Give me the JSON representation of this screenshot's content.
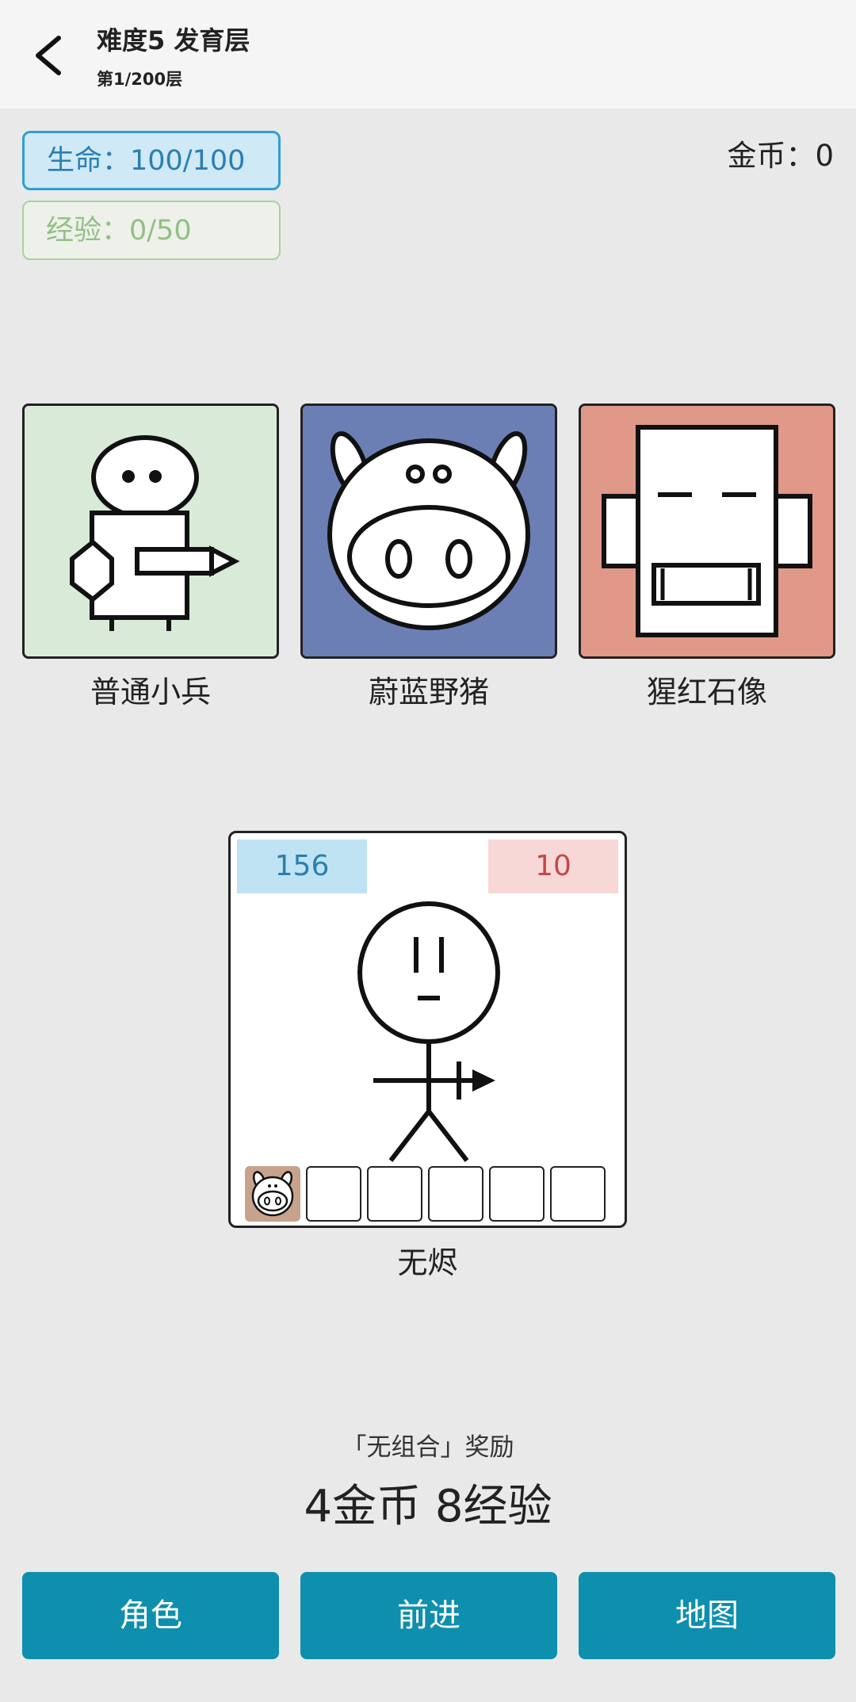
{
  "header": {
    "title": "难度5 发育层",
    "subtitle": "第1/200层"
  },
  "stats": {
    "hp_label": "生命：100/100",
    "xp_label": "经验：0/50",
    "gold_label": "金币：0"
  },
  "enemies": [
    {
      "name": "普通小兵",
      "bg_color": "#d9ead9"
    },
    {
      "name": "蔚蓝野猪",
      "bg_color": "#6b7fb5"
    },
    {
      "name": "猩红石像",
      "bg_color": "#e09888"
    }
  ],
  "hero": {
    "attack": "156",
    "defense": "10",
    "name": "无烬",
    "slots": [
      "pig",
      "",
      "",
      "",
      "",
      ""
    ]
  },
  "reward": {
    "label": "「无组合」奖励",
    "value": "4金币 8经验"
  },
  "buttons": {
    "role": "角色",
    "forward": "前进",
    "map": "地图"
  },
  "colors": {
    "button": "#0d8fad",
    "hp_border": "#2e9fd4",
    "xp_border": "#a8d39a"
  }
}
